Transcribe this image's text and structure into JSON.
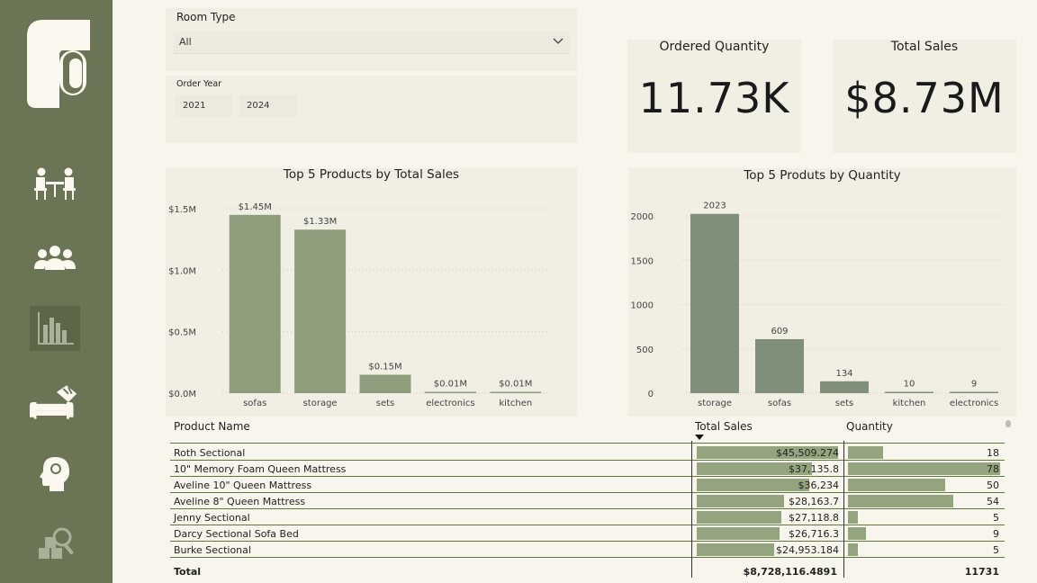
{
  "sidebar": {
    "icons": [
      "brand-logo-icon",
      "meeting-icon",
      "people-icon",
      "bar-chart-icon",
      "sofa-icon",
      "idea-head-icon",
      "analysis-icon"
    ],
    "active_color": "#5d6649",
    "bg_color": "#6b7555"
  },
  "filters": {
    "room_type_label": "Room Type",
    "room_type_value": "All",
    "order_year_label": "Order Year",
    "year_from": "2021",
    "year_to": "2024"
  },
  "kpis": {
    "ordered_quantity_label": "Ordered Quantity",
    "ordered_quantity_value": "11.73K",
    "total_sales_label": "Total Sales",
    "total_sales_value": "$8.73M"
  },
  "chart_data": [
    {
      "type": "bar",
      "title": "Top 5 Products by Total Sales",
      "categories": [
        "sofas",
        "storage",
        "sets",
        "electronics",
        "kitchen"
      ],
      "values": [
        1.45,
        1.33,
        0.15,
        0.01,
        0.01
      ],
      "data_labels": [
        "$1.45M",
        "$1.33M",
        "$0.15M",
        "$0.01M",
        "$0.01M"
      ],
      "yticks": [
        "$0.0M",
        "$0.5M",
        "$1.0M",
        "$1.5M"
      ],
      "ylim": [
        0,
        1.5
      ],
      "color": "#8e9e7c",
      "grid": true
    },
    {
      "type": "bar",
      "title": "Top 5 Produts by Quantity",
      "categories": [
        "storage",
        "sofas",
        "sets",
        "kitchen",
        "electronics"
      ],
      "values": [
        2023,
        609,
        134,
        10,
        9
      ],
      "data_labels": [
        "2023",
        "609",
        "134",
        "10",
        "9"
      ],
      "yticks": [
        "0",
        "500",
        "1000",
        "1500",
        "2000"
      ],
      "ylim": [
        0,
        2000
      ],
      "color": "#7f8f79",
      "grid": true
    }
  ],
  "table": {
    "headers": {
      "name": "Product Name",
      "sales": "Total Sales",
      "quantity": "Quantity"
    },
    "rows": [
      {
        "name": "Roth Sectional",
        "sales": "$45,509.274",
        "sales_val": 45509.274,
        "quantity": "18",
        "qty_val": 18
      },
      {
        "name": "10\" Memory Foam Queen Mattress",
        "sales": "$37,135.8",
        "sales_val": 37135.8,
        "quantity": "78",
        "qty_val": 78
      },
      {
        "name": "Aveline 10\" Queen Mattress",
        "sales": "$36,234",
        "sales_val": 36234,
        "quantity": "50",
        "qty_val": 50
      },
      {
        "name": "Aveline 8\" Queen Mattress",
        "sales": "$28,163.7",
        "sales_val": 28163.7,
        "quantity": "54",
        "qty_val": 54
      },
      {
        "name": "Jenny Sectional",
        "sales": "$27,118.8",
        "sales_val": 27118.8,
        "quantity": "5",
        "qty_val": 5
      },
      {
        "name": "Darcy Sectional Sofa Bed",
        "sales": "$26,716.3",
        "sales_val": 26716.3,
        "quantity": "9",
        "qty_val": 9
      },
      {
        "name": "Burke Sectional",
        "sales": "$24,953.184",
        "sales_val": 24953.184,
        "quantity": "5",
        "qty_val": 5
      }
    ],
    "total_label": "Total",
    "total_sales": "$8,728,116.4891",
    "total_quantity": "11731"
  }
}
